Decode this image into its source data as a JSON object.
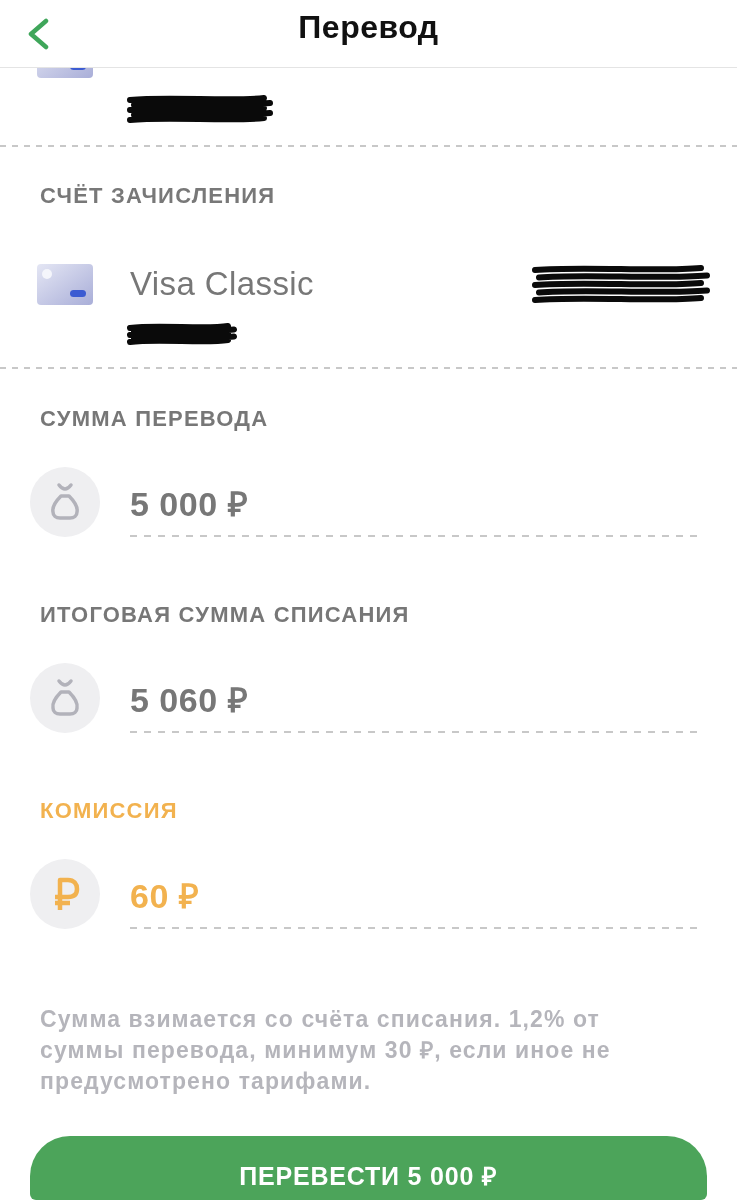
{
  "header": {
    "title": "Перевод"
  },
  "destination_account": {
    "label": "СЧЁТ ЗАЧИСЛЕНИЯ",
    "name": "Visa Classic"
  },
  "amount_fields": [
    {
      "label": "СУММА ПЕРЕВОДА",
      "value": "5 000 ₽",
      "kind": "bag",
      "color": "#777777"
    },
    {
      "label": "ИТОГОВАЯ СУММА СПИСАНИЯ",
      "value": "5 060 ₽",
      "kind": "bag",
      "color": "#777777"
    },
    {
      "label": "КОМИССИЯ",
      "value": "60 ₽",
      "kind": "ruble",
      "color": "#f2b24f"
    }
  ],
  "note": "Сумма взимается со счёта списания. 1,2% от суммы перевода, минимум 30 ₽, если иное не предусмотрено тарифами.",
  "submit_button": {
    "label": "ПЕРЕВЕСТИ 5 000 ₽"
  }
}
